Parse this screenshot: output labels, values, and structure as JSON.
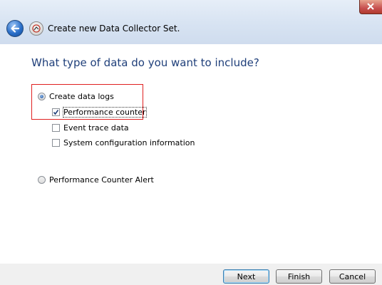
{
  "window": {
    "title": "Create new Data Collector Set."
  },
  "heading": "What type of data do you want to include?",
  "options": {
    "data_logs": {
      "label": "Create data logs",
      "selected": true
    },
    "perf_counter": {
      "label": "Performance counter",
      "checked": true
    },
    "event_trace": {
      "label": "Event trace data",
      "checked": false
    },
    "sys_config": {
      "label": "System configuration information",
      "checked": false
    },
    "alert": {
      "label": "Performance Counter Alert",
      "selected": false
    }
  },
  "buttons": {
    "next": "Next",
    "finish": "Finish",
    "cancel": "Cancel"
  },
  "icons": {
    "back": "back-arrow-icon",
    "app": "data-collector-icon",
    "close": "close-icon"
  },
  "colors": {
    "heading": "#1f3f7a",
    "highlight": "#e02020"
  }
}
